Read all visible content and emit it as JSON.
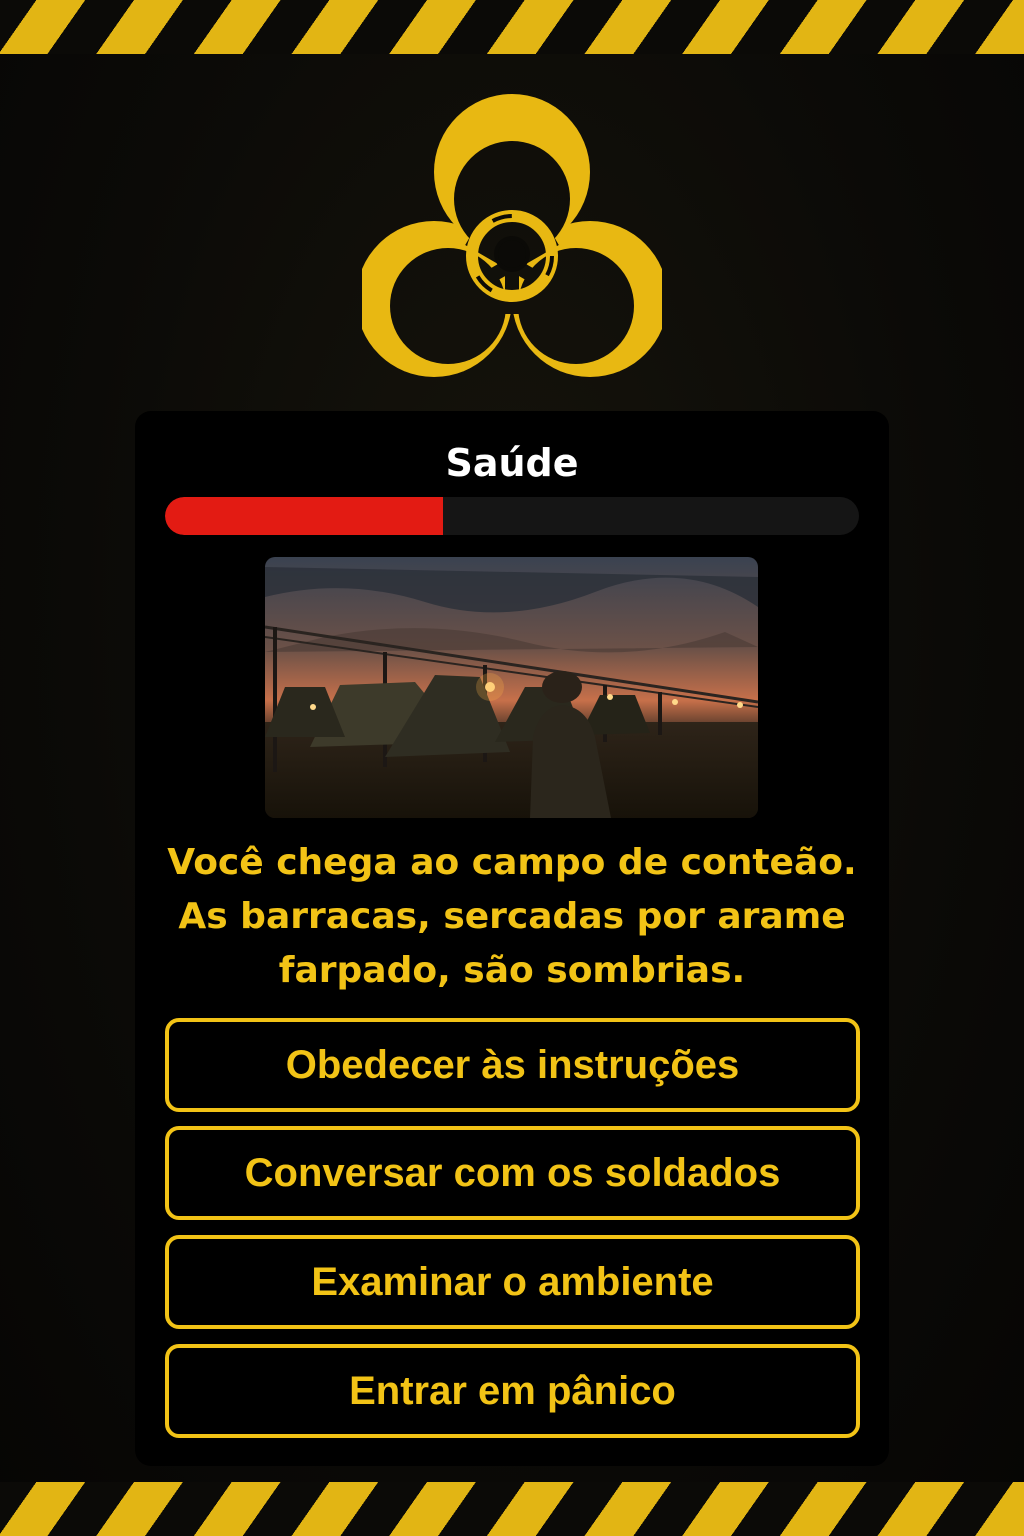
{
  "colors": {
    "hazard_yellow": "#e2b514",
    "text_yellow": "#f2c316",
    "health_red": "#e31b13",
    "panel_black": "#000000"
  },
  "header": {
    "emblem_icon": "biohazard-icon"
  },
  "status": {
    "health_label": "Saúde",
    "health_fraction": 0.4
  },
  "scene": {
    "image_icon": "military-camp-scene"
  },
  "story": {
    "text": "Você chega ao campo de conteão. As barracas, sercadas por arame farpado, são sombrias."
  },
  "choices": [
    {
      "label": "Obedecer às instruções"
    },
    {
      "label": "Conversar com os soldados"
    },
    {
      "label": "Examinar o ambiente"
    },
    {
      "label": "Entrar em pânico"
    }
  ]
}
